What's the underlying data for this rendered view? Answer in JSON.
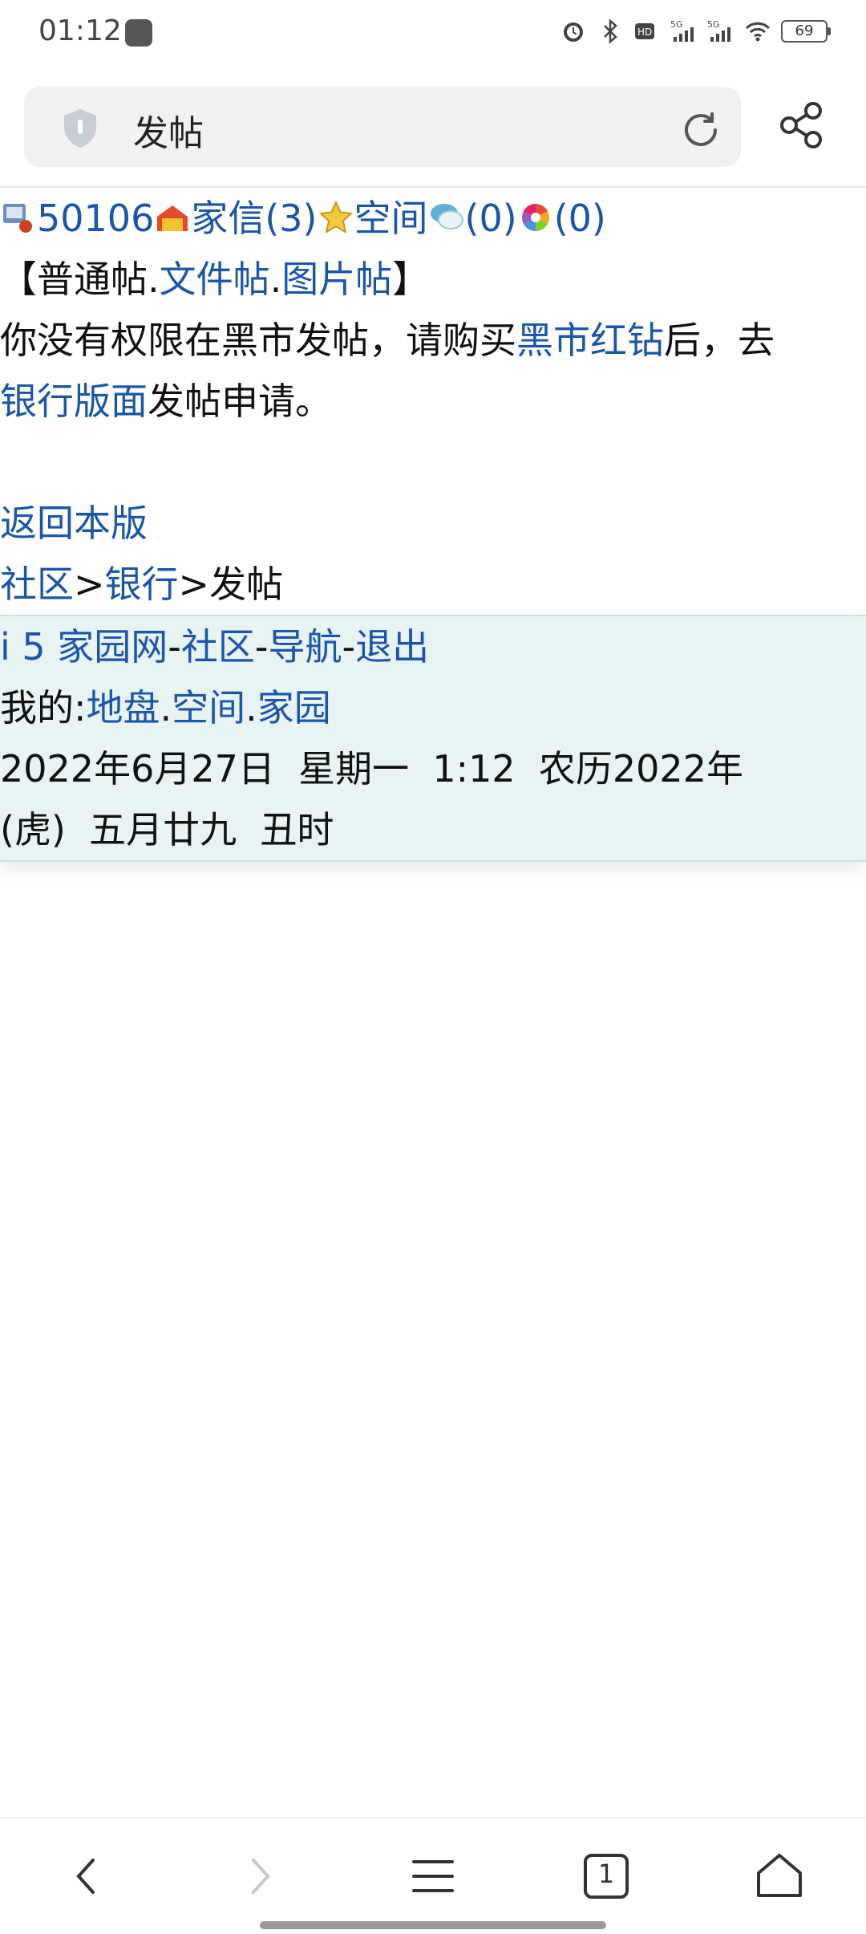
{
  "status_bar": {
    "time": "01:12",
    "battery": "69"
  },
  "toolbar": {
    "page_title": "发帖"
  },
  "content": {
    "user_id": "50106",
    "mail_link": "家信(3)",
    "space_link": "空间",
    "chat_count": "(0)",
    "photo_count": "(0)",
    "bracket_open": "【",
    "normal_post": "普通帖",
    "dot1": ".",
    "file_post": "文件帖",
    "dot2": ".",
    "image_post": "图片帖",
    "bracket_close": "】",
    "notice_part1": "你没有权限在黑市发帖，请购买",
    "notice_link1": "黑市红钻",
    "notice_part2": "后，去",
    "notice_link2": "银行版面",
    "notice_part3": "发帖申请。",
    "back_link": "返回本版",
    "breadcrumb_community": "社区",
    "breadcrumb_sep1": ">",
    "breadcrumb_bank": "银行",
    "breadcrumb_sep2": ">",
    "breadcrumb_current": "发帖"
  },
  "footer": {
    "site_link": "i 5 家园网",
    "sep": "-",
    "community_link": "社区",
    "nav_link": "导航",
    "logout_link": "退出",
    "my_label": "我的:",
    "territory_link": "地盘",
    "dot": ".",
    "space_link": "空间",
    "home_link": "家园",
    "date_line": "2022年6月27日  星期一  1:12  农历2022年",
    "lunar_line": "(虎)  五月廿九  丑时"
  },
  "bottom_nav": {
    "tab_count": "1"
  }
}
